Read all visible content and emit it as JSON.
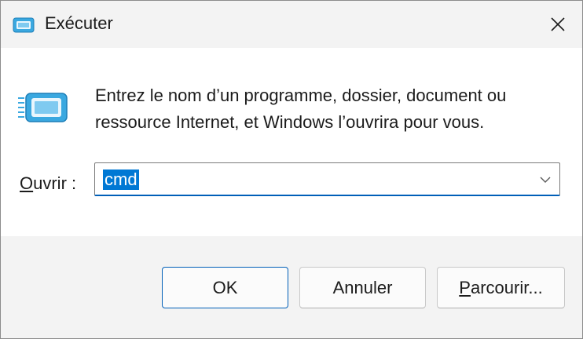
{
  "window": {
    "title": "Exécuter",
    "title_icon": "run-dialog-icon",
    "close_icon": "close-icon"
  },
  "content": {
    "icon": "run-dialog-icon",
    "description": "Entrez le nom d’un programme, dossier, document ou ressource Internet, et Windows l’ouvrira pour vous.",
    "open_label_accel": "O",
    "open_label_rest": "uvrir :",
    "open_value": "cmd",
    "dropdown_icon": "chevron-down-icon"
  },
  "buttons": {
    "ok": "OK",
    "cancel": "Annuler",
    "browse_accel": "P",
    "browse_rest": "arcourir..."
  },
  "colors": {
    "accent": "#005fb8",
    "selection": "#0078d4",
    "icon_blue": "#3aa8e0"
  }
}
